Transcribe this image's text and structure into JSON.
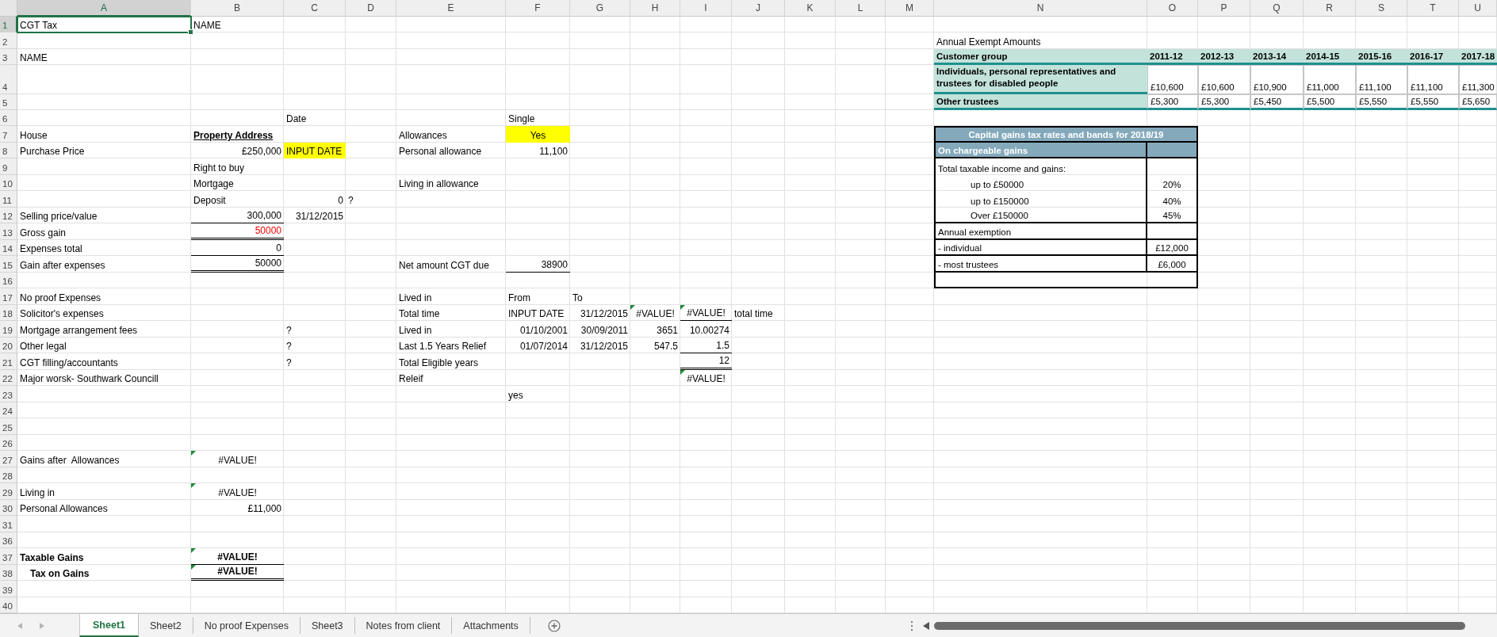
{
  "columns": [
    {
      "label": "A",
      "selected": true
    },
    {
      "label": "B",
      "selected": false
    },
    {
      "label": "C",
      "selected": false
    },
    {
      "label": "D",
      "selected": false
    },
    {
      "label": "E",
      "selected": false
    },
    {
      "label": "F",
      "selected": false
    },
    {
      "label": "G",
      "selected": false
    },
    {
      "label": "H",
      "selected": false
    },
    {
      "label": "I",
      "selected": false
    },
    {
      "label": "J",
      "selected": false
    },
    {
      "label": "K",
      "selected": false
    },
    {
      "label": "L",
      "selected": false
    },
    {
      "label": "M",
      "selected": false
    },
    {
      "label": "N",
      "selected": false
    },
    {
      "label": "O",
      "selected": false
    },
    {
      "label": "P",
      "selected": false
    },
    {
      "label": "Q",
      "selected": false
    },
    {
      "label": "R",
      "selected": false
    },
    {
      "label": "S",
      "selected": false
    },
    {
      "label": "T",
      "selected": false
    },
    {
      "label": "U",
      "selected": false
    }
  ],
  "rows": [
    {
      "number": "1",
      "selected": true,
      "cells": {
        "A": {
          "text": "CGT Tax",
          "selected": true
        },
        "B": {
          "text": "NAME"
        }
      }
    },
    {
      "number": "2",
      "selected": false,
      "cells": {
        "N": {
          "text": "Annual Exempt Amounts"
        }
      }
    },
    {
      "number": "3",
      "selected": false,
      "cells": {
        "A": {
          "text": "NAME"
        },
        "N": {
          "text": "Customer group",
          "kind": "teal-head"
        },
        "O": {
          "text": "2011-12",
          "kind": "teal-head"
        },
        "P": {
          "text": "2012-13",
          "kind": "teal-head"
        },
        "Q": {
          "text": "2013-14",
          "kind": "teal-head"
        },
        "R": {
          "text": "2014-15",
          "kind": "teal-head"
        },
        "S": {
          "text": "2015-16",
          "kind": "teal-head"
        },
        "T": {
          "text": "2016-17",
          "kind": "teal-head"
        },
        "U": {
          "text": "2017-18",
          "kind": "teal-head"
        }
      }
    },
    {
      "number": "4",
      "selected": false,
      "cells": {
        "N": {
          "text": "Individuals, personal representatives and trustees for disabled people",
          "kind": "teal-wrap"
        },
        "O": {
          "text": "£10,600",
          "kind": "amount"
        },
        "P": {
          "text": "£10,600",
          "kind": "amount"
        },
        "Q": {
          "text": "£10,900",
          "kind": "amount"
        },
        "R": {
          "text": "£11,000",
          "kind": "amount"
        },
        "S": {
          "text": "£11,100",
          "kind": "amount"
        },
        "T": {
          "text": "£11,100",
          "kind": "amount"
        },
        "U": {
          "text": "£11,300",
          "kind": "amount"
        }
      }
    },
    {
      "number": "5",
      "selected": false,
      "cells": {
        "N": {
          "text": "Other trustees",
          "kind": "teal-head"
        },
        "O": {
          "text": "£5,300",
          "kind": "amount-last"
        },
        "P": {
          "text": "£5,300",
          "kind": "amount-last"
        },
        "Q": {
          "text": "£5,450",
          "kind": "amount-last"
        },
        "R": {
          "text": "£5,500",
          "kind": "amount-last"
        },
        "S": {
          "text": "£5,550",
          "kind": "amount-last"
        },
        "T": {
          "text": "£5,550",
          "kind": "amount-last"
        },
        "U": {
          "text": "£5,650",
          "kind": "amount-last"
        }
      }
    },
    {
      "number": "6",
      "selected": false,
      "cells": {
        "C": {
          "text": "Date"
        },
        "F": {
          "text": "Single"
        }
      }
    },
    {
      "number": "7",
      "selected": false,
      "cells": {
        "A": {
          "text": "House"
        },
        "B": {
          "text": "Property Address",
          "kind": "heading"
        },
        "E": {
          "text": "Allowances"
        },
        "F": {
          "text": "Yes",
          "kind": "input-center"
        },
        "N": {
          "text": "Capital gains tax rates and bands for 2018/19",
          "kind": "band-title"
        }
      }
    },
    {
      "number": "8",
      "selected": false,
      "cells": {
        "A": {
          "text": "Purchase Price"
        },
        "B": {
          "text": "£250,000",
          "kind": "number"
        },
        "C": {
          "text": "INPUT DATE",
          "kind": "input"
        },
        "E": {
          "text": "Personal allowance"
        },
        "F": {
          "text": "11,100",
          "kind": "number"
        },
        "N": {
          "text": "On chargeable gains",
          "kind": "band-head"
        },
        "O": {
          "kind": "band-fill"
        }
      }
    },
    {
      "number": "9",
      "selected": false,
      "cells": {
        "B": {
          "text": "Right to buy"
        },
        "N": {
          "text": "Total taxable income and gains:",
          "kind": "rate-label"
        },
        "O": {
          "kind": "rate-value"
        }
      }
    },
    {
      "number": "10",
      "selected": false,
      "cells": {
        "B": {
          "text": "Mortgage"
        },
        "E": {
          "text": "Living in allowance"
        },
        "N": {
          "text": "up to £50000",
          "kind": "rate-item"
        },
        "O": {
          "text": "20%",
          "kind": "rate-value"
        }
      }
    },
    {
      "number": "11",
      "selected": false,
      "cells": {
        "B": {
          "text": "Deposit"
        },
        "C": {
          "text": "0",
          "kind": "number"
        },
        "D": {
          "text": "?"
        },
        "N": {
          "text": "up to £150000",
          "kind": "rate-item"
        },
        "O": {
          "text": "40%",
          "kind": "rate-value"
        }
      }
    },
    {
      "number": "12",
      "selected": false,
      "cells": {
        "A": {
          "text": "Selling price/value"
        },
        "B": {
          "text": "300,000",
          "kind": "total"
        },
        "C": {
          "text": "31/12/2015",
          "kind": "number"
        },
        "N": {
          "text": "Over £150000",
          "kind": "rate-item-last"
        },
        "O": {
          "text": "45%",
          "kind": "rate-value-last"
        }
      }
    },
    {
      "number": "13",
      "selected": false,
      "cells": {
        "A": {
          "text": "Gross gain"
        },
        "B": {
          "text": "50000",
          "kind": "grand-total",
          "color": "#ff0000"
        },
        "N": {
          "text": "Annual exemption",
          "kind": "rate-row"
        },
        "O": {
          "kind": "rate-value-last"
        }
      }
    },
    {
      "number": "14",
      "selected": false,
      "cells": {
        "A": {
          "text": "Expenses total"
        },
        "B": {
          "text": "0",
          "kind": "total"
        },
        "N": {
          "text": "- individual",
          "kind": "rate-row"
        },
        "O": {
          "text": "£12,000",
          "kind": "rate-value-last"
        }
      }
    },
    {
      "number": "15",
      "selected": false,
      "cells": {
        "A": {
          "text": "Gain after expenses"
        },
        "B": {
          "text": "50000",
          "kind": "grand-total"
        },
        "E": {
          "text": "Net amount CGT due"
        },
        "F": {
          "text": "38900",
          "kind": "total"
        },
        "N": {
          "text": "- most trustees",
          "kind": "rate-row"
        },
        "O": {
          "text": "£6,000",
          "kind": "rate-value-last"
        }
      }
    },
    {
      "number": "16",
      "selected": false,
      "cells": {
        "N": {
          "kind": "rate-footer"
        }
      }
    },
    {
      "number": "17",
      "selected": false,
      "cells": {
        "A": {
          "text": "No proof Expenses"
        },
        "E": {
          "text": "Lived in"
        },
        "F": {
          "text": "From"
        },
        "G": {
          "text": "To"
        }
      }
    },
    {
      "number": "18",
      "selected": false,
      "cells": {
        "A": {
          "text": "Solicitor's expenses"
        },
        "E": {
          "text": "Total time"
        },
        "F": {
          "text": "INPUT DATE"
        },
        "G": {
          "text": "31/12/2015",
          "kind": "number"
        },
        "H": {
          "text": "#VALUE!",
          "kind": "centered",
          "flag": true
        },
        "I": {
          "text": "#VALUE!",
          "kind": "centered-total",
          "flag": true
        },
        "J": {
          "text": "total time"
        }
      }
    },
    {
      "number": "19",
      "selected": false,
      "cells": {
        "A": {
          "text": "Mortgage arrangement fees"
        },
        "C": {
          "text": "?"
        },
        "E": {
          "text": "Lived in"
        },
        "F": {
          "text": "01/10/2001",
          "kind": "number"
        },
        "G": {
          "text": "30/09/2011",
          "kind": "number"
        },
        "H": {
          "text": "3651",
          "kind": "number"
        },
        "I": {
          "text": "10.00274",
          "kind": "number"
        }
      }
    },
    {
      "number": "20",
      "selected": false,
      "cells": {
        "A": {
          "text": "Other legal"
        },
        "C": {
          "text": "?"
        },
        "E": {
          "text": "Last 1.5 Years Relief"
        },
        "F": {
          "text": "01/07/2014",
          "kind": "number"
        },
        "G": {
          "text": "31/12/2015",
          "kind": "number"
        },
        "H": {
          "text": "547.5",
          "kind": "number"
        },
        "I": {
          "text": "1.5",
          "kind": "total"
        }
      }
    },
    {
      "number": "21",
      "selected": false,
      "cells": {
        "A": {
          "text": "CGT filling/accountants"
        },
        "C": {
          "text": "?"
        },
        "E": {
          "text": "Total Eligible years"
        },
        "I": {
          "text": "12",
          "kind": "grand-total"
        }
      }
    },
    {
      "number": "22",
      "selected": false,
      "cells": {
        "A": {
          "text": "Major worsk- Southwark Councill"
        },
        "E": {
          "text": "Releif"
        },
        "I": {
          "text": "#VALUE!",
          "kind": "centered",
          "flag": true
        }
      }
    },
    {
      "number": "23",
      "selected": false,
      "cells": {
        "F": {
          "text": "yes"
        }
      }
    },
    {
      "number": "24",
      "selected": false,
      "cells": {}
    },
    {
      "number": "25",
      "selected": false,
      "cells": {}
    },
    {
      "number": "26",
      "selected": false,
      "cells": {}
    },
    {
      "number": "27",
      "selected": false,
      "cells": {
        "A": {
          "text": "Gains after  Allowances"
        },
        "B": {
          "text": "#VALUE!",
          "kind": "centered",
          "flag": true
        }
      }
    },
    {
      "number": "28",
      "selected": false,
      "cells": {}
    },
    {
      "number": "29",
      "selected": false,
      "cells": {
        "A": {
          "text": "Living in"
        },
        "B": {
          "text": "#VALUE!",
          "kind": "centered",
          "flag": true
        }
      }
    },
    {
      "number": "30",
      "selected": false,
      "cells": {
        "A": {
          "text": "Personal Allowances"
        },
        "B": {
          "text": "£11,000",
          "kind": "number"
        }
      }
    },
    {
      "number": "31",
      "selected": false,
      "cells": {}
    },
    {
      "number": "36",
      "selected": false,
      "cells": {}
    },
    {
      "number": "37",
      "selected": false,
      "cells": {
        "A": {
          "text": "Taxable Gains",
          "bold": true
        },
        "B": {
          "text": "#VALUE!",
          "bold": true,
          "kind": "centered-total",
          "flag": true
        }
      }
    },
    {
      "number": "38",
      "selected": false,
      "cells": {
        "A": {
          "text": "Tax on Gains",
          "bold": true,
          "kind": "indented"
        },
        "B": {
          "text": "#VALUE!",
          "bold": true,
          "kind": "centered-grand",
          "flag": true
        }
      }
    },
    {
      "number": "39",
      "selected": false,
      "cells": {}
    },
    {
      "number": "40",
      "selected": false,
      "cells": {}
    }
  ],
  "sheet_tabs": [
    {
      "label": "Sheet1",
      "selected": true
    },
    {
      "label": "Sheet2",
      "selected": false
    },
    {
      "label": "No proof Expenses",
      "selected": false
    },
    {
      "label": "Sheet3",
      "selected": false
    },
    {
      "label": "Notes from client",
      "selected": false
    },
    {
      "label": "Attachments",
      "selected": false
    }
  ]
}
